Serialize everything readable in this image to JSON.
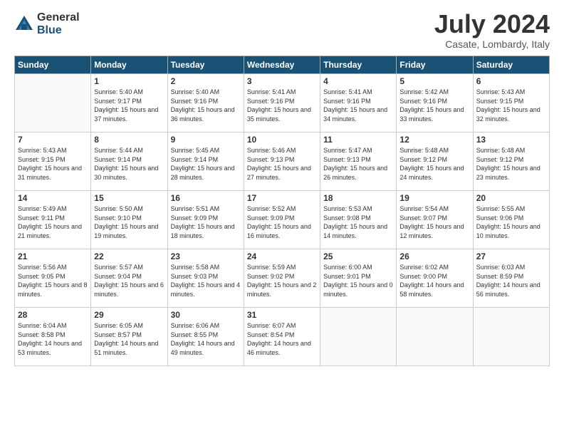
{
  "header": {
    "logo_general": "General",
    "logo_blue": "Blue",
    "month_title": "July 2024",
    "location": "Casate, Lombardy, Italy"
  },
  "calendar": {
    "headers": [
      "Sunday",
      "Monday",
      "Tuesday",
      "Wednesday",
      "Thursday",
      "Friday",
      "Saturday"
    ],
    "rows": [
      [
        {
          "day": "",
          "sunrise": "",
          "sunset": "",
          "daylight": ""
        },
        {
          "day": "1",
          "sunrise": "Sunrise: 5:40 AM",
          "sunset": "Sunset: 9:17 PM",
          "daylight": "Daylight: 15 hours and 37 minutes."
        },
        {
          "day": "2",
          "sunrise": "Sunrise: 5:40 AM",
          "sunset": "Sunset: 9:16 PM",
          "daylight": "Daylight: 15 hours and 36 minutes."
        },
        {
          "day": "3",
          "sunrise": "Sunrise: 5:41 AM",
          "sunset": "Sunset: 9:16 PM",
          "daylight": "Daylight: 15 hours and 35 minutes."
        },
        {
          "day": "4",
          "sunrise": "Sunrise: 5:41 AM",
          "sunset": "Sunset: 9:16 PM",
          "daylight": "Daylight: 15 hours and 34 minutes."
        },
        {
          "day": "5",
          "sunrise": "Sunrise: 5:42 AM",
          "sunset": "Sunset: 9:16 PM",
          "daylight": "Daylight: 15 hours and 33 minutes."
        },
        {
          "day": "6",
          "sunrise": "Sunrise: 5:43 AM",
          "sunset": "Sunset: 9:15 PM",
          "daylight": "Daylight: 15 hours and 32 minutes."
        }
      ],
      [
        {
          "day": "7",
          "sunrise": "Sunrise: 5:43 AM",
          "sunset": "Sunset: 9:15 PM",
          "daylight": "Daylight: 15 hours and 31 minutes."
        },
        {
          "day": "8",
          "sunrise": "Sunrise: 5:44 AM",
          "sunset": "Sunset: 9:14 PM",
          "daylight": "Daylight: 15 hours and 30 minutes."
        },
        {
          "day": "9",
          "sunrise": "Sunrise: 5:45 AM",
          "sunset": "Sunset: 9:14 PM",
          "daylight": "Daylight: 15 hours and 28 minutes."
        },
        {
          "day": "10",
          "sunrise": "Sunrise: 5:46 AM",
          "sunset": "Sunset: 9:13 PM",
          "daylight": "Daylight: 15 hours and 27 minutes."
        },
        {
          "day": "11",
          "sunrise": "Sunrise: 5:47 AM",
          "sunset": "Sunset: 9:13 PM",
          "daylight": "Daylight: 15 hours and 26 minutes."
        },
        {
          "day": "12",
          "sunrise": "Sunrise: 5:48 AM",
          "sunset": "Sunset: 9:12 PM",
          "daylight": "Daylight: 15 hours and 24 minutes."
        },
        {
          "day": "13",
          "sunrise": "Sunrise: 5:48 AM",
          "sunset": "Sunset: 9:12 PM",
          "daylight": "Daylight: 15 hours and 23 minutes."
        }
      ],
      [
        {
          "day": "14",
          "sunrise": "Sunrise: 5:49 AM",
          "sunset": "Sunset: 9:11 PM",
          "daylight": "Daylight: 15 hours and 21 minutes."
        },
        {
          "day": "15",
          "sunrise": "Sunrise: 5:50 AM",
          "sunset": "Sunset: 9:10 PM",
          "daylight": "Daylight: 15 hours and 19 minutes."
        },
        {
          "day": "16",
          "sunrise": "Sunrise: 5:51 AM",
          "sunset": "Sunset: 9:09 PM",
          "daylight": "Daylight: 15 hours and 18 minutes."
        },
        {
          "day": "17",
          "sunrise": "Sunrise: 5:52 AM",
          "sunset": "Sunset: 9:09 PM",
          "daylight": "Daylight: 15 hours and 16 minutes."
        },
        {
          "day": "18",
          "sunrise": "Sunrise: 5:53 AM",
          "sunset": "Sunset: 9:08 PM",
          "daylight": "Daylight: 15 hours and 14 minutes."
        },
        {
          "day": "19",
          "sunrise": "Sunrise: 5:54 AM",
          "sunset": "Sunset: 9:07 PM",
          "daylight": "Daylight: 15 hours and 12 minutes."
        },
        {
          "day": "20",
          "sunrise": "Sunrise: 5:55 AM",
          "sunset": "Sunset: 9:06 PM",
          "daylight": "Daylight: 15 hours and 10 minutes."
        }
      ],
      [
        {
          "day": "21",
          "sunrise": "Sunrise: 5:56 AM",
          "sunset": "Sunset: 9:05 PM",
          "daylight": "Daylight: 15 hours and 8 minutes."
        },
        {
          "day": "22",
          "sunrise": "Sunrise: 5:57 AM",
          "sunset": "Sunset: 9:04 PM",
          "daylight": "Daylight: 15 hours and 6 minutes."
        },
        {
          "day": "23",
          "sunrise": "Sunrise: 5:58 AM",
          "sunset": "Sunset: 9:03 PM",
          "daylight": "Daylight: 15 hours and 4 minutes."
        },
        {
          "day": "24",
          "sunrise": "Sunrise: 5:59 AM",
          "sunset": "Sunset: 9:02 PM",
          "daylight": "Daylight: 15 hours and 2 minutes."
        },
        {
          "day": "25",
          "sunrise": "Sunrise: 6:00 AM",
          "sunset": "Sunset: 9:01 PM",
          "daylight": "Daylight: 15 hours and 0 minutes."
        },
        {
          "day": "26",
          "sunrise": "Sunrise: 6:02 AM",
          "sunset": "Sunset: 9:00 PM",
          "daylight": "Daylight: 14 hours and 58 minutes."
        },
        {
          "day": "27",
          "sunrise": "Sunrise: 6:03 AM",
          "sunset": "Sunset: 8:59 PM",
          "daylight": "Daylight: 14 hours and 56 minutes."
        }
      ],
      [
        {
          "day": "28",
          "sunrise": "Sunrise: 6:04 AM",
          "sunset": "Sunset: 8:58 PM",
          "daylight": "Daylight: 14 hours and 53 minutes."
        },
        {
          "day": "29",
          "sunrise": "Sunrise: 6:05 AM",
          "sunset": "Sunset: 8:57 PM",
          "daylight": "Daylight: 14 hours and 51 minutes."
        },
        {
          "day": "30",
          "sunrise": "Sunrise: 6:06 AM",
          "sunset": "Sunset: 8:55 PM",
          "daylight": "Daylight: 14 hours and 49 minutes."
        },
        {
          "day": "31",
          "sunrise": "Sunrise: 6:07 AM",
          "sunset": "Sunset: 8:54 PM",
          "daylight": "Daylight: 14 hours and 46 minutes."
        },
        {
          "day": "",
          "sunrise": "",
          "sunset": "",
          "daylight": ""
        },
        {
          "day": "",
          "sunrise": "",
          "sunset": "",
          "daylight": ""
        },
        {
          "day": "",
          "sunrise": "",
          "sunset": "",
          "daylight": ""
        }
      ]
    ]
  }
}
